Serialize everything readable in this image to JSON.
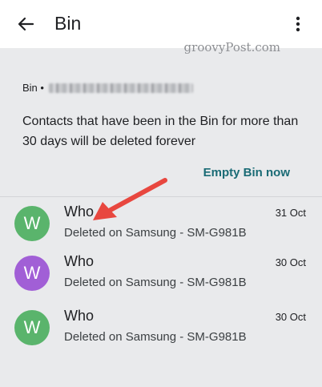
{
  "appbar": {
    "title": "Bin",
    "back_icon": "arrow-back-icon",
    "menu_icon": "more-vert-icon"
  },
  "watermark": "groovyPost.com",
  "banner": {
    "account_label": "Bin •",
    "info_text": "Contacts that have been in the Bin for more than\n30 days will be deleted forever",
    "empty_action": "Empty Bin now"
  },
  "contacts": [
    {
      "initial": "W",
      "name": "Who",
      "subtitle": "Deleted on Samsung - SM-G981B",
      "date": "31 Oct",
      "avatar_color": "#5ab46c"
    },
    {
      "initial": "W",
      "name": "Who",
      "subtitle": "Deleted on Samsung - SM-G981B",
      "date": "30 Oct",
      "avatar_color": "#a15fd6"
    },
    {
      "initial": "W",
      "name": "Who",
      "subtitle": "Deleted on Samsung - SM-G981B",
      "date": "30 Oct",
      "avatar_color": "#5ab46c"
    }
  ],
  "colors": {
    "background": "#e9eaec",
    "accent": "#1a6b75",
    "annotation_arrow": "#e8473f"
  }
}
